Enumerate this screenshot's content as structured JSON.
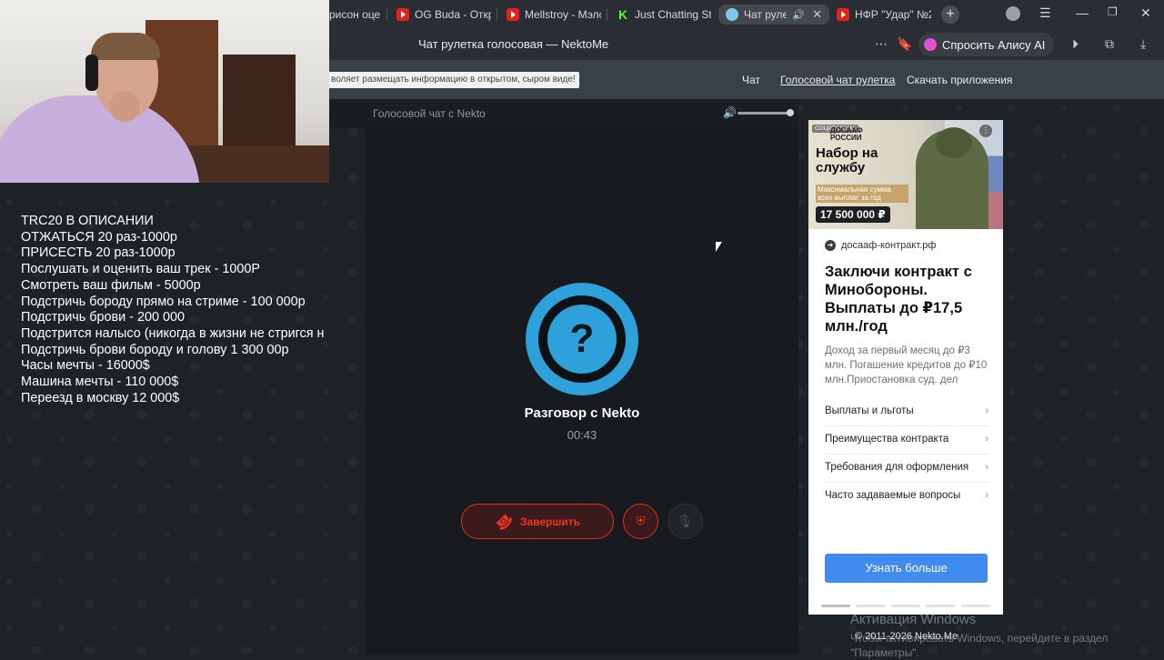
{
  "browser": {
    "tabs": [
      {
        "label": "рисон оцен",
        "icon": "youtube-icon"
      },
      {
        "label": "OG Buda - Откро",
        "icon": "youtube-icon"
      },
      {
        "label": "Mellstroy - Мэлс",
        "icon": "youtube-icon"
      },
      {
        "label": "Just Chatting Str",
        "icon": "kick-icon"
      },
      {
        "label": "Чат рулетк",
        "icon": "nekto-icon",
        "active": true
      },
      {
        "label": "НФР \"Удар\" №2",
        "icon": "youtube-icon"
      }
    ],
    "page_title": "Чат рулетка голосовая — NektoMe",
    "alice_button": "Спросить Алису AI"
  },
  "site": {
    "notice": "воляет размещать информацию в открытом, сыром виде!",
    "nav": [
      "Чат",
      "Голосовой чат рулетка",
      "Скачать приложения"
    ]
  },
  "stream_overlay": {
    "lines": [
      "TRC20 В ОПИСАНИИ",
      "ОТЖАТЬСЯ 20 раз-1000р",
      "ПРИСЕСТЬ 20 раз-1000р",
      "Послушать и оценить ваш трек - 1000Р",
      "Смотреть ваш фильм - 5000р",
      "Подстричь бороду прямо на стриме - 100 000р",
      "Подстричь брови - 200 000",
      "Подстрится налысо (никогда в жизни не стригся н",
      "Подстричь брови бороду и голову 1 300 00р",
      "Часы мечты - 16000$",
      "Машина мечты - 110 000$",
      "Переезд в москву 12 000$"
    ]
  },
  "chat": {
    "header_title": "Голосовой чат с Nekto",
    "volume_level": 0.9,
    "avatar_glyph": "?",
    "conversation_title": "Разговор с Nekto",
    "timer": "00:43",
    "end_label": "Завершить"
  },
  "ad": {
    "sponsor_label": "СОЦРЕКЛАМА",
    "brand": "ДОСААФ РОССИИ",
    "banner_headline": "Набор на службу",
    "banner_small": "Максимальная сумма всех выплат за год",
    "banner_amount": "17 500 000 ₽",
    "domain": "досааф-контракт.рф",
    "title": "Заключи контракт с Минобороны. Выплаты до ₽17,5 млн./год",
    "description": "Доход за первый месяц до ₽3 млн. Погашение кредитов до ₽10 млн.Приостановка суд. дел",
    "links": [
      "Выплаты и льготы",
      "Преимущества контракта",
      "Требования для оформления",
      "Часто задаваемые вопросы"
    ],
    "cta": "Узнать больше",
    "slide_count": 5,
    "active_slide": 1
  },
  "footer": {
    "copyright": "© 2011-2026 Nekto.Me",
    "windows_watermark_title": "Активация Windows",
    "windows_watermark_sub": "Чтобы активировать Windows, перейдите в раздел \"Параметры\"."
  }
}
